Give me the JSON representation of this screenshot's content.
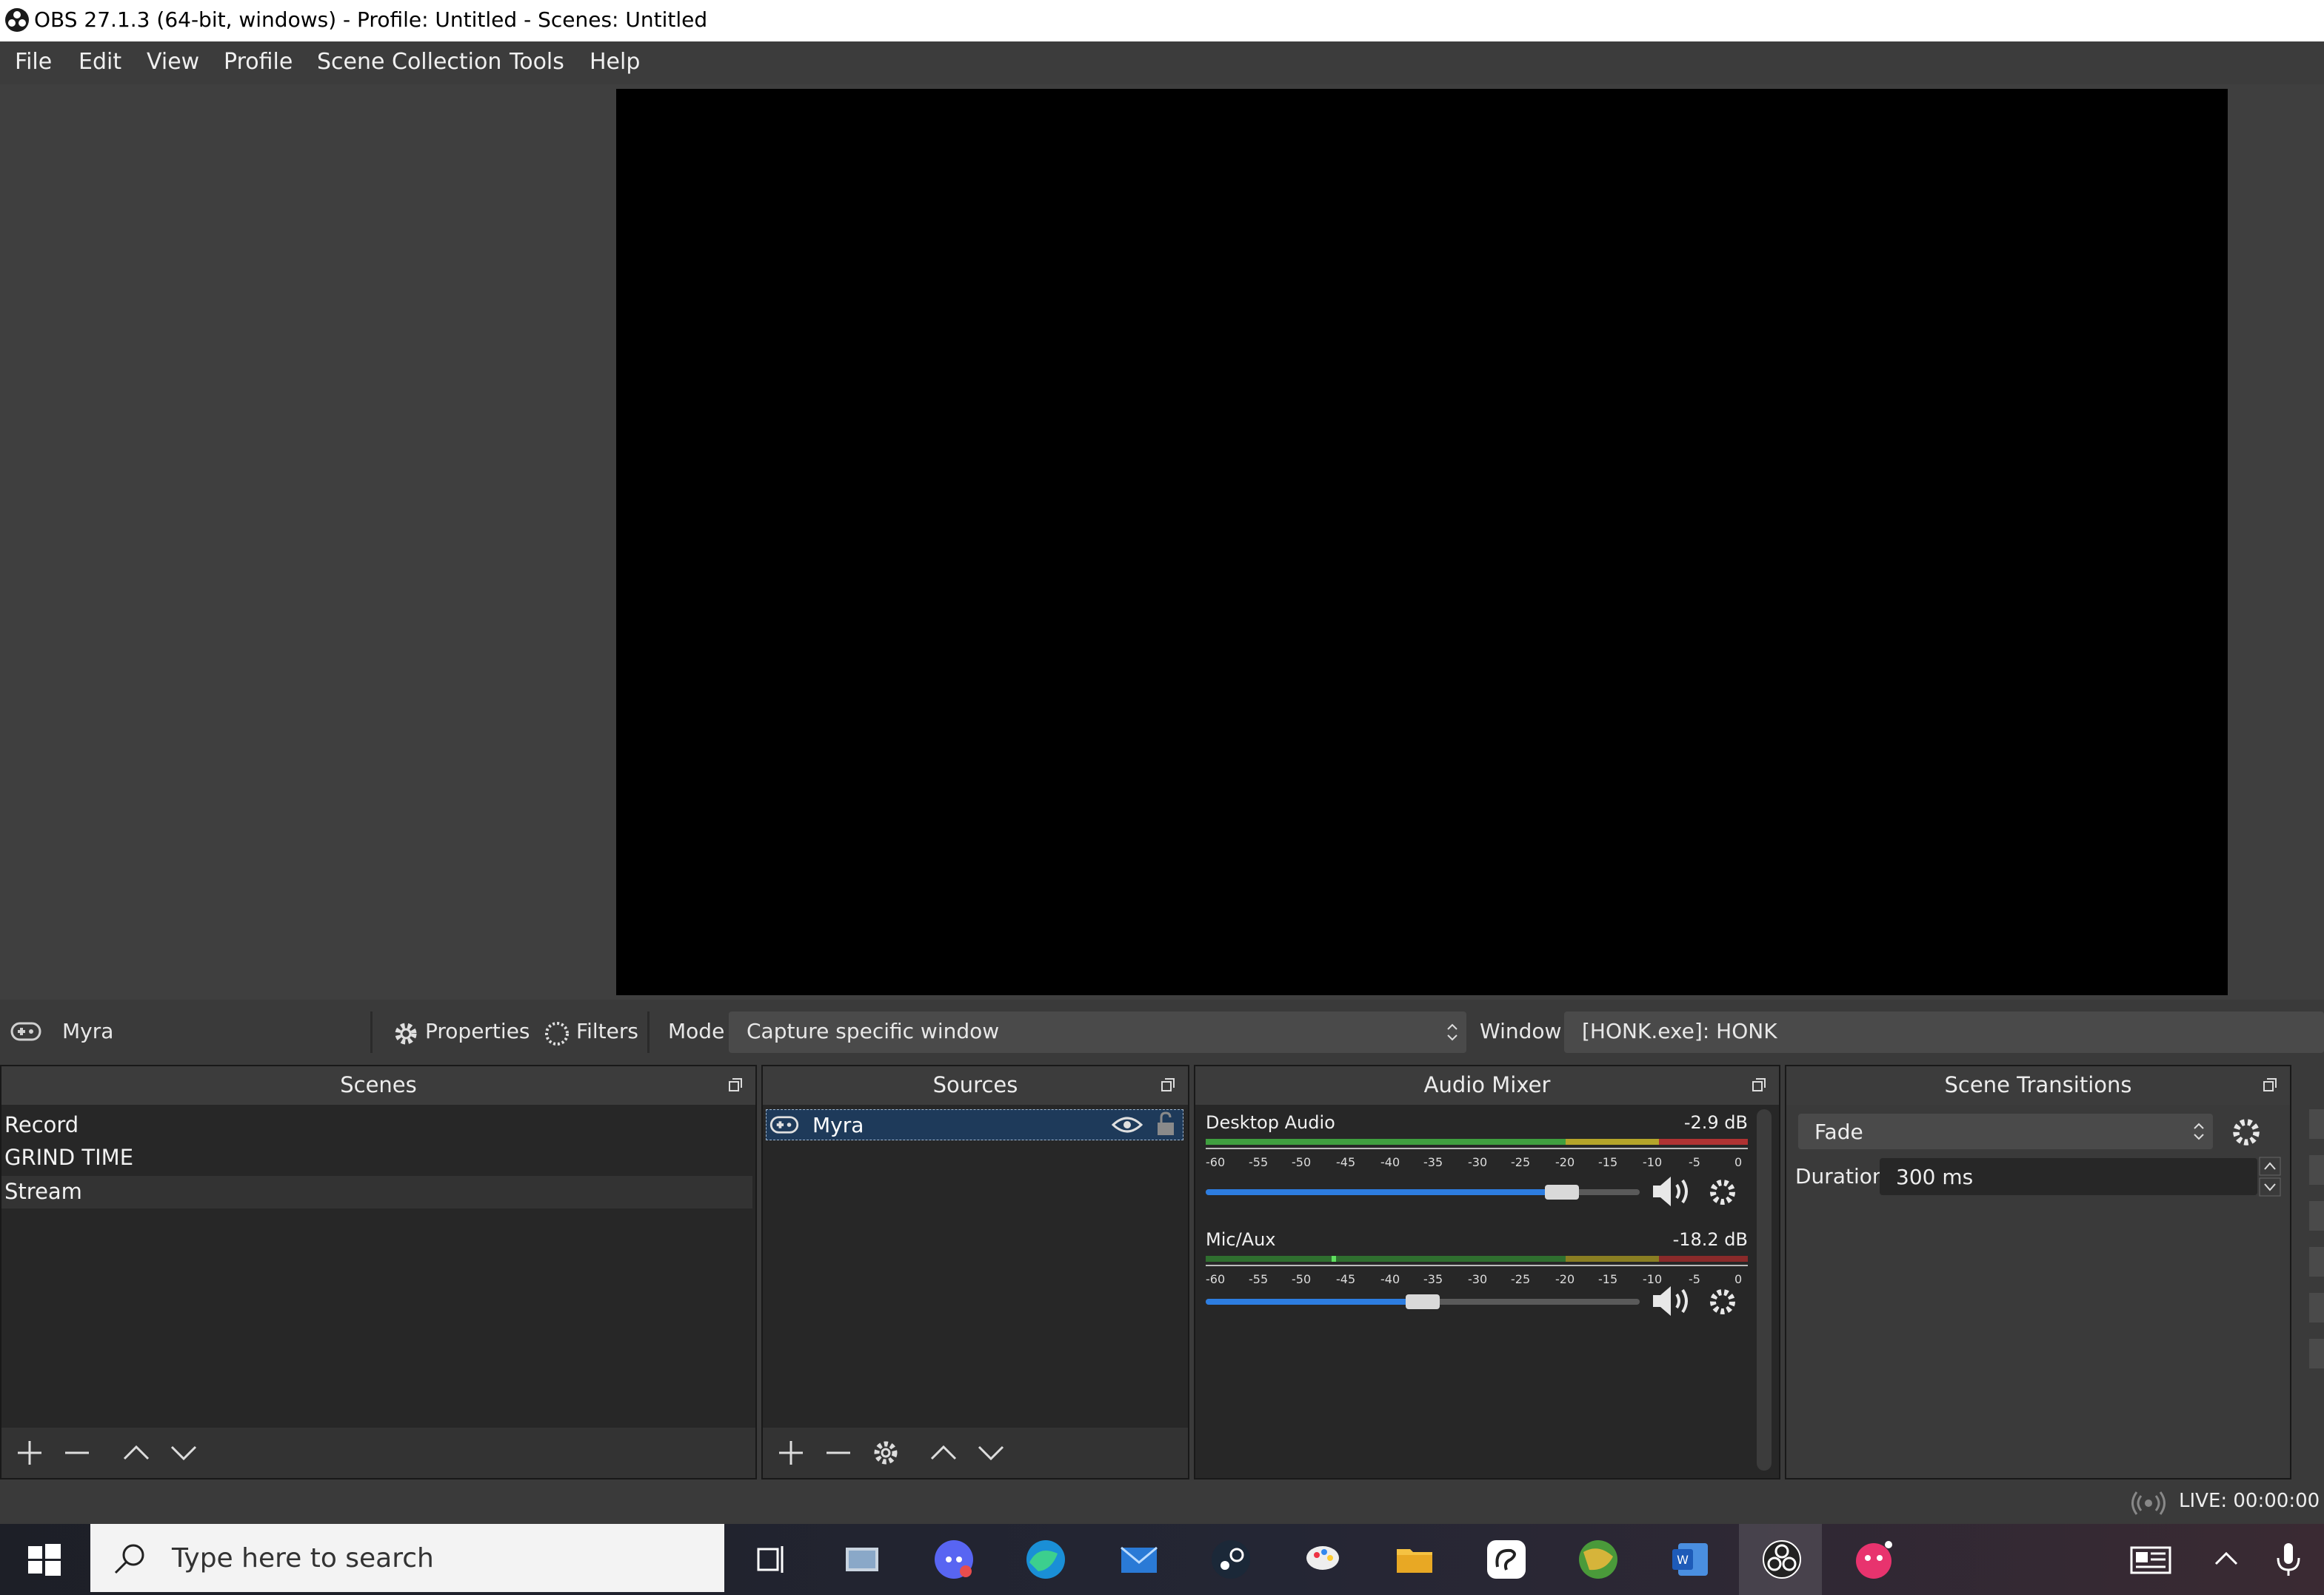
{
  "window": {
    "title": "OBS 27.1.3 (64-bit, windows) - Profile: Untitled - Scenes: Untitled"
  },
  "menu": [
    "File",
    "Edit",
    "View",
    "Profile",
    "Scene Collection",
    "Tools",
    "Help"
  ],
  "source_toolbar": {
    "source_name": "Myra",
    "properties_label": "Properties",
    "filters_label": "Filters",
    "mode_label": "Mode",
    "mode_value": "Capture specific window",
    "window_label": "Window",
    "window_value": "[HONK.exe]: HONK"
  },
  "scenes": {
    "title": "Scenes",
    "items": [
      "Record",
      "GRIND TIME",
      "Stream"
    ],
    "selected": "Stream"
  },
  "sources": {
    "title": "Sources",
    "items": [
      {
        "name": "Myra",
        "visible": true,
        "locked": false
      }
    ]
  },
  "audio_mixer": {
    "title": "Audio Mixer",
    "scale_ticks": [
      "-60",
      "-55",
      "-50",
      "-45",
      "-40",
      "-35",
      "-30",
      "-25",
      "-20",
      "-15",
      "-10",
      "-5",
      "0"
    ],
    "channels": [
      {
        "name": "Desktop Audio",
        "db": "-2.9 dB",
        "volume_fraction": 0.82
      },
      {
        "name": "Mic/Aux",
        "db": "-18.2 dB",
        "volume_fraction": 0.5
      }
    ]
  },
  "scene_transitions": {
    "title": "Scene Transitions",
    "transition": "Fade",
    "duration_label": "Duration",
    "duration_value": "300 ms"
  },
  "status": {
    "live": "LIVE: 00:00:00"
  },
  "taskbar": {
    "search_placeholder": "Type here to search",
    "apps": [
      "task-view",
      "file-explorer-alt",
      "discord",
      "edge",
      "mail",
      "steam",
      "paint",
      "folder",
      "clip-studio",
      "game-globe",
      "word",
      "obs",
      "pink-app"
    ]
  },
  "colors": {
    "accent": "#2d7de0",
    "meter_green": "#3f9f3f",
    "meter_yellow": "#b5a52a",
    "meter_red": "#b03232"
  }
}
